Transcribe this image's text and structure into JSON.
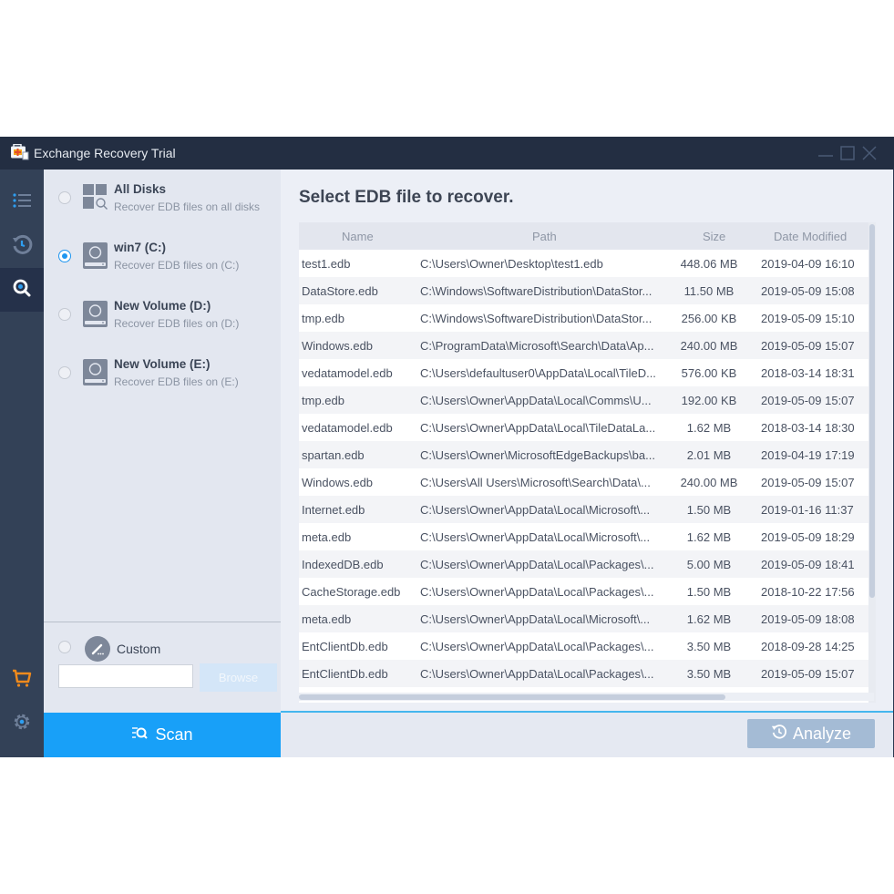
{
  "window": {
    "title": "Exchange Recovery Trial",
    "controls": [
      "minimize",
      "maximize",
      "close"
    ]
  },
  "rail": {
    "items": [
      {
        "icon": "list-icon",
        "active": false
      },
      {
        "icon": "history-icon",
        "active": false
      },
      {
        "icon": "search-icon",
        "active": true
      },
      {
        "icon": "cart-icon",
        "active": false
      },
      {
        "icon": "gear-icon",
        "active": false
      }
    ]
  },
  "disks": [
    {
      "name": "All Disks",
      "sub": "Recover EDB files on all disks",
      "selected": false,
      "icon": "all-disks-icon"
    },
    {
      "name": "win7 (C:)",
      "sub": "Recover EDB files on (C:)",
      "selected": true,
      "icon": "disk-icon"
    },
    {
      "name": "New Volume (D:)",
      "sub": "Recover EDB files on (D:)",
      "selected": false,
      "icon": "disk-icon"
    },
    {
      "name": "New Volume (E:)",
      "sub": "Recover EDB files on (E:)",
      "selected": false,
      "icon": "disk-icon"
    }
  ],
  "custom": {
    "label": "Custom",
    "input_value": "",
    "browse_label": "Browse"
  },
  "scan": {
    "label": "Scan"
  },
  "main": {
    "title": "Select EDB file to recover.",
    "columns": [
      "Name",
      "Path",
      "Size",
      "Date Modified"
    ],
    "rows": [
      {
        "name": "test1.edb",
        "path": "C:\\Users\\Owner\\Desktop\\test1.edb",
        "size": "448.06 MB",
        "date": "2019-04-09 16:10"
      },
      {
        "name": "DataStore.edb",
        "path": "C:\\Windows\\SoftwareDistribution\\DataStor...",
        "size": "11.50 MB",
        "date": "2019-05-09 15:08"
      },
      {
        "name": "tmp.edb",
        "path": "C:\\Windows\\SoftwareDistribution\\DataStor...",
        "size": "256.00 KB",
        "date": "2019-05-09 15:10"
      },
      {
        "name": "Windows.edb",
        "path": "C:\\ProgramData\\Microsoft\\Search\\Data\\Ap...",
        "size": "240.00 MB",
        "date": "2019-05-09 15:07"
      },
      {
        "name": "vedatamodel.edb",
        "path": "C:\\Users\\defaultuser0\\AppData\\Local\\TileD...",
        "size": "576.00 KB",
        "date": "2018-03-14 18:31"
      },
      {
        "name": "tmp.edb",
        "path": "C:\\Users\\Owner\\AppData\\Local\\Comms\\U...",
        "size": "192.00 KB",
        "date": "2019-05-09 15:07"
      },
      {
        "name": "vedatamodel.edb",
        "path": "C:\\Users\\Owner\\AppData\\Local\\TileDataLa...",
        "size": "1.62 MB",
        "date": "2018-03-14 18:30"
      },
      {
        "name": "spartan.edb",
        "path": "C:\\Users\\Owner\\MicrosoftEdgeBackups\\ba...",
        "size": "2.01 MB",
        "date": "2019-04-19 17:19"
      },
      {
        "name": "Windows.edb",
        "path": "C:\\Users\\All Users\\Microsoft\\Search\\Data\\...",
        "size": "240.00 MB",
        "date": "2019-05-09 15:07"
      },
      {
        "name": "Internet.edb",
        "path": "C:\\Users\\Owner\\AppData\\Local\\Microsoft\\...",
        "size": "1.50 MB",
        "date": "2019-01-16 11:37"
      },
      {
        "name": "meta.edb",
        "path": "C:\\Users\\Owner\\AppData\\Local\\Microsoft\\...",
        "size": "1.62 MB",
        "date": "2019-05-09 18:29"
      },
      {
        "name": "IndexedDB.edb",
        "path": "C:\\Users\\Owner\\AppData\\Local\\Packages\\...",
        "size": "5.00 MB",
        "date": "2019-05-09 18:41"
      },
      {
        "name": "CacheStorage.edb",
        "path": "C:\\Users\\Owner\\AppData\\Local\\Packages\\...",
        "size": "1.50 MB",
        "date": "2018-10-22 17:56"
      },
      {
        "name": "meta.edb",
        "path": "C:\\Users\\Owner\\AppData\\Local\\Microsoft\\...",
        "size": "1.62 MB",
        "date": "2019-05-09 18:08"
      },
      {
        "name": "EntClientDb.edb",
        "path": "C:\\Users\\Owner\\AppData\\Local\\Packages\\...",
        "size": "3.50 MB",
        "date": "2018-09-28 14:25"
      },
      {
        "name": "EntClientDb.edb",
        "path": "C:\\Users\\Owner\\AppData\\Local\\Packages\\...",
        "size": "3.50 MB",
        "date": "2019-05-09 15:07"
      }
    ]
  },
  "analyze": {
    "label": "Analyze",
    "enabled": false
  },
  "colors": {
    "titlebar": "#232e42",
    "rail": "#334157",
    "accent": "#18a0f8",
    "cart": "#f08a1c",
    "analyze_disabled": "#a4bbd5"
  }
}
